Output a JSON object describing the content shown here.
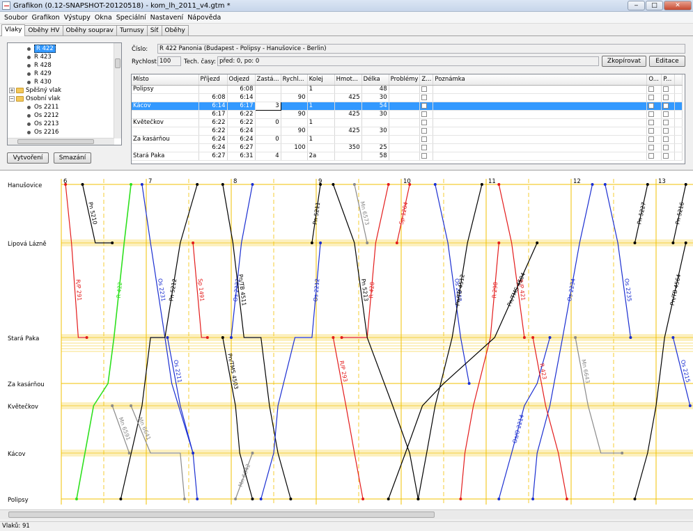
{
  "window": {
    "title": "Grafikon (0.12-SNAPSHOT-20120518) - kom_lh_2011_v4.gtm *",
    "buttons": {
      "minimize": "‒",
      "maximize": "□",
      "close": "✕"
    }
  },
  "menu": [
    "Soubor",
    "Grafikon",
    "Výstupy",
    "Okna",
    "Speciální",
    "Nastavení",
    "Nápověda"
  ],
  "tabs": [
    "Vlaky",
    "Oběhy HV",
    "Oběhy souprav",
    "Turnusy",
    "Síť",
    "Oběhy"
  ],
  "active_tab": "Vlaky",
  "tree": {
    "items": [
      {
        "label": "R 422",
        "type": "train",
        "selected": true
      },
      {
        "label": "R 423",
        "type": "train"
      },
      {
        "label": "R 428",
        "type": "train"
      },
      {
        "label": "R 429",
        "type": "train"
      },
      {
        "label": "R 430",
        "type": "train"
      },
      {
        "label": "Spěšný vlak",
        "type": "group",
        "expander": "+"
      },
      {
        "label": "Osobní vlak",
        "type": "group",
        "expander": "−"
      },
      {
        "label": "Os 2211",
        "type": "train"
      },
      {
        "label": "Os 2212",
        "type": "train"
      },
      {
        "label": "Os 2213",
        "type": "train"
      },
      {
        "label": "Os 2216",
        "type": "train"
      }
    ],
    "create_button": "Vytvoření",
    "delete_button": "Smazání"
  },
  "train_detail": {
    "number_label": "Číslo:",
    "number_value": "R 422 Panonia (Budapest - Polipsy - Hanušovice - Berlin)",
    "speed_label": "Rychlost:",
    "speed_value": "100",
    "tech_label": "Tech. časy:",
    "tech_value": "před: 0, po: 0",
    "copy_button": "Zkopírovat",
    "edit_button": "Editace"
  },
  "timetable": {
    "columns": [
      "Místo",
      "Příjezd",
      "Odjezd",
      "Zastá...",
      "Rychl...",
      "Kolej",
      "Hmot...",
      "Délka",
      "Problémy",
      "Z...",
      "Poznámka",
      "O...",
      "P..."
    ],
    "rows": [
      {
        "place": "Polipsy",
        "arr": "",
        "dep": "6:08",
        "stop": "",
        "speed": "",
        "track": "1",
        "weight": "",
        "length": "48",
        "selected": false
      },
      {
        "place": "",
        "arr": "6:08",
        "dep": "6:14",
        "stop": "",
        "speed": "90",
        "track": "",
        "weight": "425",
        "length": "30",
        "selected": false
      },
      {
        "place": "Kácov",
        "arr": "6:14",
        "dep": "6:17",
        "stop": "3",
        "speed": "",
        "track": "1",
        "weight": "",
        "length": "54",
        "selected": true
      },
      {
        "place": "",
        "arr": "6:17",
        "dep": "6:22",
        "stop": "",
        "speed": "90",
        "track": "",
        "weight": "425",
        "length": "30",
        "selected": false
      },
      {
        "place": "Květečkov",
        "arr": "6:22",
        "dep": "6:22",
        "stop": "0",
        "speed": "",
        "track": "1",
        "weight": "",
        "length": "",
        "selected": false
      },
      {
        "place": "",
        "arr": "6:22",
        "dep": "6:24",
        "stop": "",
        "speed": "90",
        "track": "",
        "weight": "425",
        "length": "30",
        "selected": false
      },
      {
        "place": "Za kasárňou",
        "arr": "6:24",
        "dep": "6:24",
        "stop": "0",
        "speed": "",
        "track": "1",
        "weight": "",
        "length": "",
        "selected": false
      },
      {
        "place": "",
        "arr": "6:24",
        "dep": "6:27",
        "stop": "",
        "speed": "100",
        "track": "",
        "weight": "350",
        "length": "25",
        "selected": false
      },
      {
        "place": "Stará Paka",
        "arr": "6:27",
        "dep": "6:31",
        "stop": "4",
        "speed": "",
        "track": "2a",
        "weight": "",
        "length": "58",
        "selected": false
      }
    ]
  },
  "graph": {
    "stations": [
      "Hanušovice",
      "Lipová Lázně",
      "Stará Paka",
      "Za kasárňou",
      "Květečkov",
      "Kácov",
      "Polipsy"
    ],
    "hours": [
      "7",
      "8",
      "9",
      "10",
      "11",
      "12",
      "13"
    ],
    "hour_label_first": "6",
    "colors": {
      "express": "#e31b1b",
      "passenger": "#1a2ed1",
      "fast": "#000000",
      "freight": "#8a8a8a",
      "highlight": "#2ee01e",
      "grid_hour": "#f2c200",
      "grid_station": "#f2c200"
    },
    "train_labels": [
      {
        "text": "R 422",
        "color": "highlight"
      },
      {
        "text": "R/P 291",
        "color": "express"
      },
      {
        "text": "Pn 5210",
        "color": "fast"
      },
      {
        "text": "Os 2231",
        "color": "passenger"
      },
      {
        "text": "Pn 5212",
        "color": "fast"
      },
      {
        "text": "Sp 1491",
        "color": "express"
      },
      {
        "text": "Os 2232",
        "color": "passenger"
      },
      {
        "text": "Pn/TB 4511",
        "color": "fast"
      },
      {
        "text": "Pn 5211",
        "color": "fast"
      },
      {
        "text": "Os 2212",
        "color": "passenger"
      },
      {
        "text": "R 428",
        "color": "express"
      },
      {
        "text": "Mn 6573",
        "color": "freight"
      },
      {
        "text": "Sp 1204",
        "color": "express"
      },
      {
        "text": "Os 2233",
        "color": "passenger"
      },
      {
        "text": "Pn 5213",
        "color": "fast"
      },
      {
        "text": "Pn/TB 4512",
        "color": "fast"
      },
      {
        "text": "R 298",
        "color": "express"
      },
      {
        "text": "R/P 421",
        "color": "express"
      },
      {
        "text": "Os 2234",
        "color": "passenger"
      },
      {
        "text": "Os 2235",
        "color": "passenger"
      },
      {
        "text": "Pn 5227",
        "color": "fast"
      },
      {
        "text": "Pn 5216",
        "color": "fast"
      },
      {
        "text": "R/P 293",
        "color": "express"
      },
      {
        "text": "Mn 6642",
        "color": "freight"
      },
      {
        "text": "Pn/TMS 4503",
        "color": "fast"
      },
      {
        "text": "Pn/TMS 4504",
        "color": "fast"
      },
      {
        "text": "Os/O 2214",
        "color": "passenger"
      },
      {
        "text": "R 423",
        "color": "express"
      },
      {
        "text": "Mn 6643",
        "color": "freight"
      },
      {
        "text": "Pn/TB 4564",
        "color": "fast"
      },
      {
        "text": "Os 2215",
        "color": "passenger"
      },
      {
        "text": "Mn 6641",
        "color": "freight"
      },
      {
        "text": "Os 2211",
        "color": "passenger"
      },
      {
        "text": "Mn 6591",
        "color": "freight"
      }
    ]
  },
  "status": {
    "text": "Vlaků: 91"
  }
}
